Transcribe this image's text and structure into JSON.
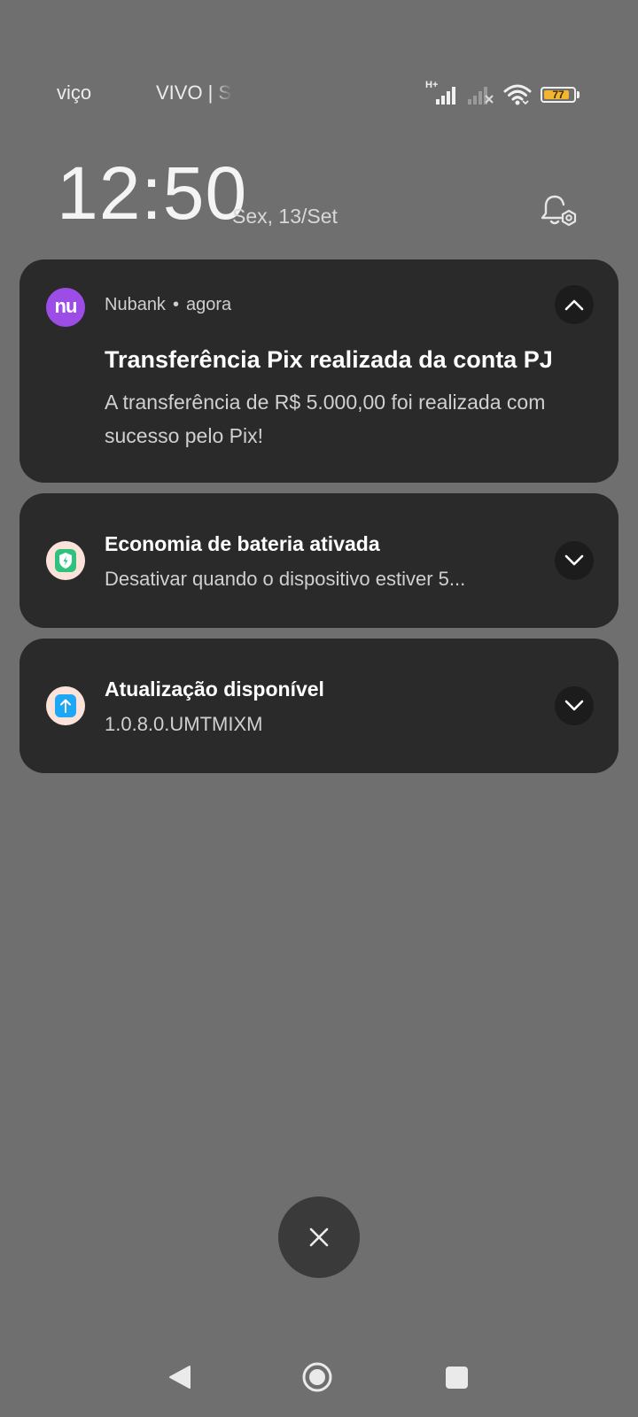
{
  "status_bar": {
    "carrier_1": "viço",
    "carrier_2": "VIVO | S",
    "network_type": "H+",
    "battery_level": "77",
    "icons": [
      "signal-h-plus-icon",
      "signal-no-service-icon",
      "wifi-icon",
      "battery-icon"
    ],
    "battery_color": "#f2b531"
  },
  "header": {
    "time": "12:50",
    "date": "Sex, 13/Set",
    "settings_icon": "notification-settings-icon"
  },
  "notifications": [
    {
      "app": "Nubank",
      "separator": "•",
      "time": "agora",
      "icon_text": "nu",
      "icon_color": "#9c4de6",
      "title": "Transferência Pix realizada da conta PJ",
      "body": "A transferência de R$ 5.000,00 foi realizada com sucesso pelo Pix!",
      "expanded": true
    },
    {
      "title": "Economia de bateria ativada",
      "body": "Desativar quando o dispositivo estiver 5...",
      "icon": "battery-saver-shield-icon",
      "expanded": false
    },
    {
      "title": "Atualização disponível",
      "body": "1.0.8.0.UMTMIXM",
      "icon": "system-update-icon",
      "expanded": false
    }
  ],
  "colors": {
    "background": "#6f6f6f",
    "card": "#2a2a2a",
    "shield_green": "#2ec27e",
    "update_blue": "#1ea7f5"
  }
}
